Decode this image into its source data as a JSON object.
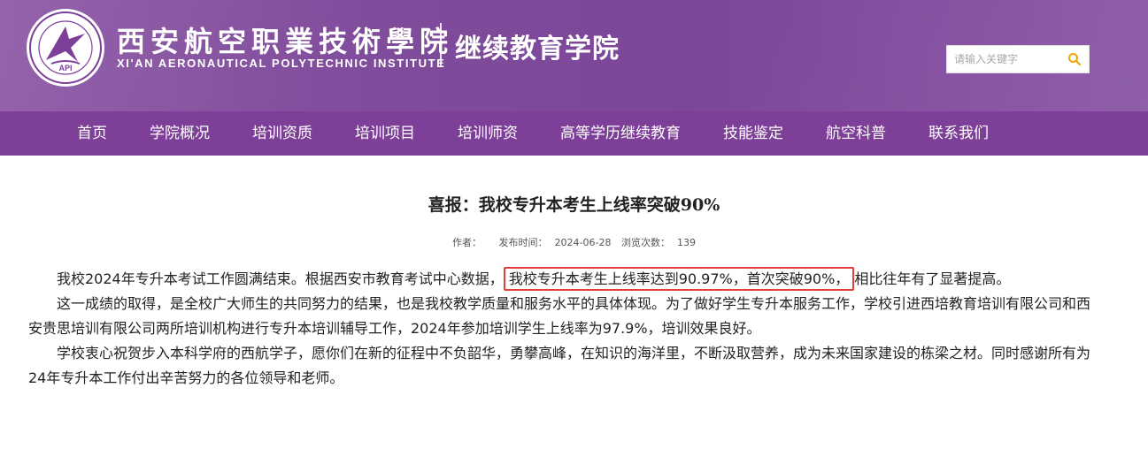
{
  "header": {
    "school_name_cn": "西安航空职業技術學院",
    "school_name_en": "XI'AN AERONAUTICAL POLYTECHNIC INSTITUTE",
    "logo_text": "API",
    "college_name": "继续教育学院",
    "search": {
      "placeholder": "请输入关键字",
      "icon": "search-icon"
    },
    "colors": {
      "header_bg": "#8455a3",
      "nav_bg": "#7d3f98",
      "search_icon": "#f0a500"
    }
  },
  "nav": {
    "items": [
      {
        "label": "首页"
      },
      {
        "label": "学院概况"
      },
      {
        "label": "培训资质"
      },
      {
        "label": "培训项目"
      },
      {
        "label": "培训师资"
      },
      {
        "label": "高等学历继续教育"
      },
      {
        "label": "技能鉴定"
      },
      {
        "label": "航空科普"
      },
      {
        "label": "联系我们"
      }
    ]
  },
  "article": {
    "title": "喜报：我校专升本考生上线率突破90%",
    "meta": {
      "author_label": "作者：",
      "author_value": "",
      "date_label": "发布时间：",
      "date_value": "2024-06-28",
      "views_label": "浏览次数：",
      "views_value": "139"
    },
    "p1_before": "我校2024年专升本考试工作圆满结束。根据西安市教育考试中心数据，",
    "p1_highlight": "我校专升本考生上线率达到90.97%，首次突破90%，",
    "p1_after": "相比往年有了显著提高。",
    "p2": "这一成绩的取得，是全校广大师生的共同努力的结果，也是我校教学质量和服务水平的具体体现。为了做好学生专升本服务工作，学校引进西培教育培训有限公司和西安贵思培训有限公司两所培训机构进行专升本培训辅导工作，2024年参加培训学生上线率为97.9%，培训效果良好。",
    "p3": "学校衷心祝贺步入本科学府的西航学子，愿你们在新的征程中不负韶华，勇攀高峰，在知识的海洋里，不断汲取营养，成为未来国家建设的栋梁之材。同时感谢所有为24年专升本工作付出辛苦努力的各位领导和老师。",
    "highlight_color": "#e53c3c"
  }
}
